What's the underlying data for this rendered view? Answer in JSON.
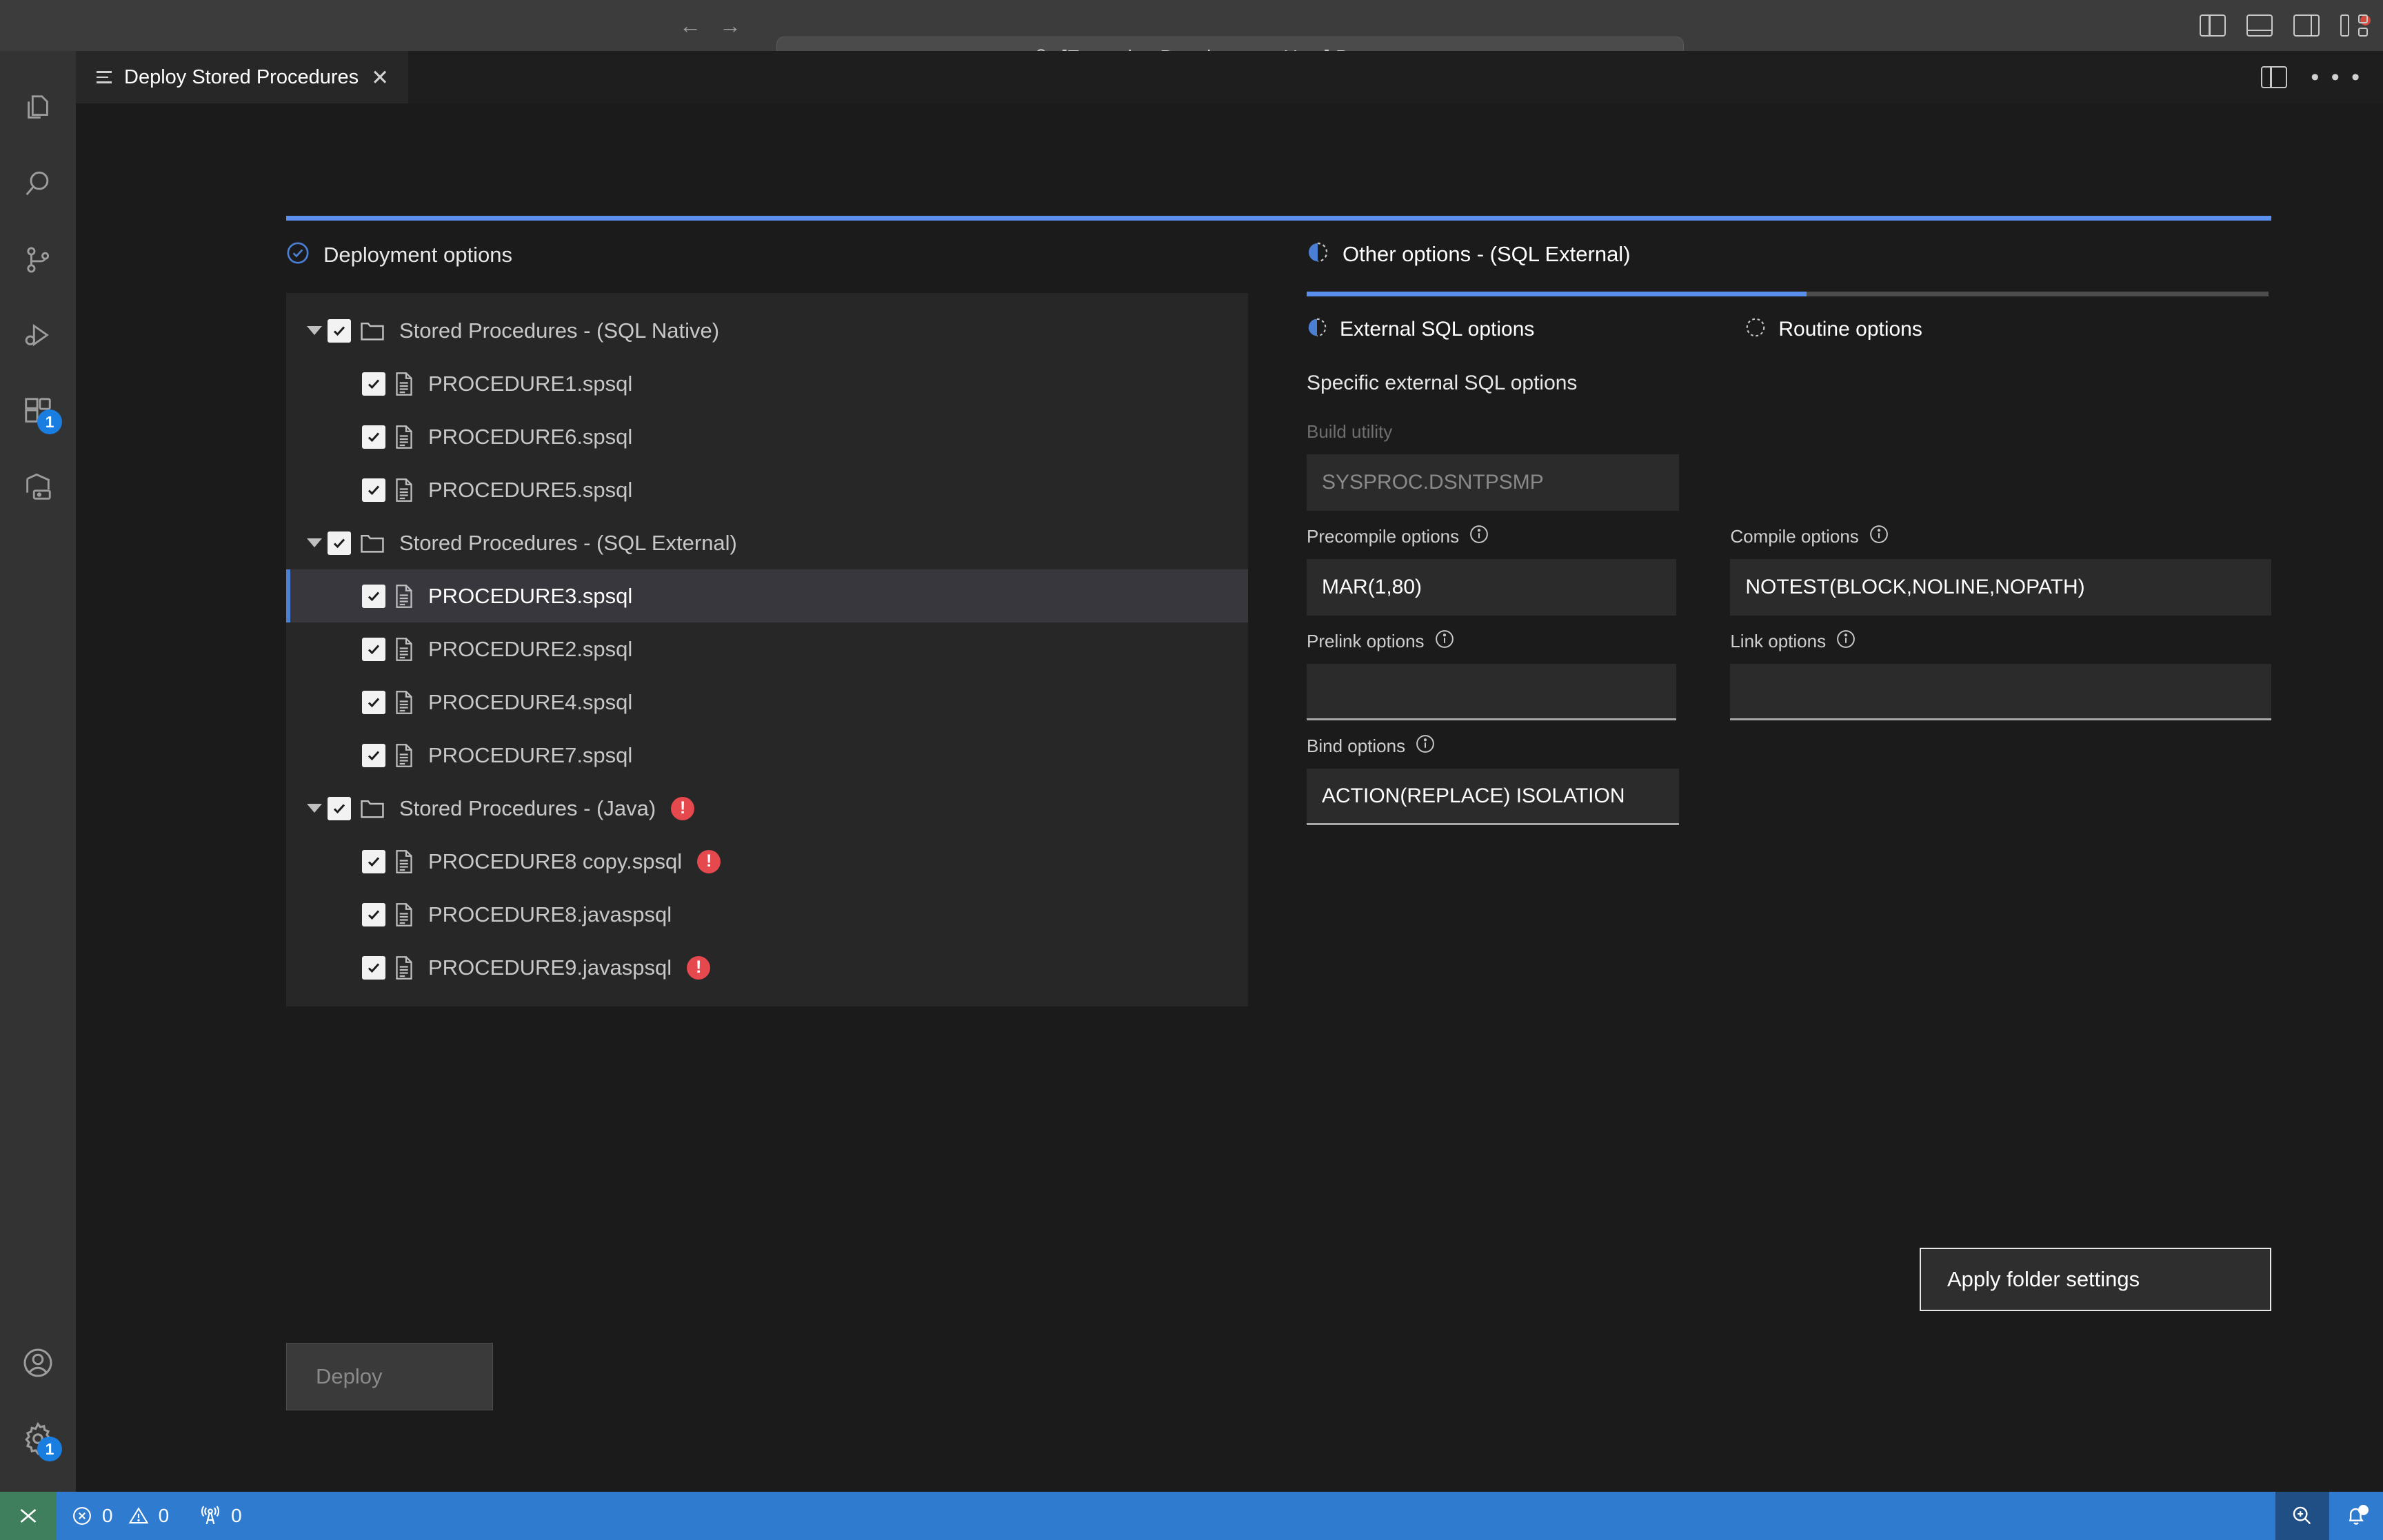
{
  "titlebar": {
    "back_icon": "arrow-left-icon",
    "forward_icon": "arrow-right-icon",
    "search_text": "[Extension Development Host] Document",
    "search_icon": "search-icon",
    "layout_buttons": [
      {
        "name": "toggle-primary-sidebar",
        "icon": "layout-sidebar-left-icon"
      },
      {
        "name": "toggle-panel",
        "icon": "layout-panel-icon"
      },
      {
        "name": "toggle-secondary-sidebar",
        "icon": "layout-sidebar-right-icon"
      },
      {
        "name": "customize-layout",
        "icon": "layout-customize-icon"
      }
    ]
  },
  "activitybar": {
    "top_items": [
      {
        "name": "explorer",
        "icon": "files-icon",
        "badge": ""
      },
      {
        "name": "search",
        "icon": "search-icon",
        "badge": ""
      },
      {
        "name": "source-control",
        "icon": "source-control-icon",
        "badge": ""
      },
      {
        "name": "run-and-debug",
        "icon": "run-debug-icon",
        "badge": ""
      },
      {
        "name": "extensions",
        "icon": "extensions-icon",
        "badge": "1"
      },
      {
        "name": "db-connections",
        "icon": "database-icon",
        "badge": ""
      }
    ],
    "bottom_items": [
      {
        "name": "accounts",
        "icon": "account-icon",
        "badge": ""
      },
      {
        "name": "manage-settings",
        "icon": "gear-icon",
        "badge": "1"
      }
    ]
  },
  "tabbar": {
    "tab_icon": "list-icon",
    "tab_title": "Deploy Stored Procedures",
    "close_icon": "close-icon",
    "split_editor_icon": "split-editor-icon",
    "more_actions_icon": "more-actions-icon",
    "more_actions_glyph": "• • •"
  },
  "left_pane": {
    "title": "Deployment options",
    "title_icon": "check-circle-icon",
    "tree": [
      {
        "type": "folder",
        "label": "Stored Procedures - (SQL Native)",
        "checked": true,
        "expanded": true,
        "error": false,
        "selected": false
      },
      {
        "type": "file",
        "label": "PROCEDURE1.spsql",
        "checked": true,
        "error": false,
        "selected": false
      },
      {
        "type": "file",
        "label": "PROCEDURE6.spsql",
        "checked": true,
        "error": false,
        "selected": false
      },
      {
        "type": "file",
        "label": "PROCEDURE5.spsql",
        "checked": true,
        "error": false,
        "selected": false
      },
      {
        "type": "folder",
        "label": "Stored Procedures - (SQL External)",
        "checked": true,
        "expanded": true,
        "error": false,
        "selected": false
      },
      {
        "type": "file",
        "label": "PROCEDURE3.spsql",
        "checked": true,
        "error": false,
        "selected": true
      },
      {
        "type": "file",
        "label": "PROCEDURE2.spsql",
        "checked": true,
        "error": false,
        "selected": false
      },
      {
        "type": "file",
        "label": "PROCEDURE4.spsql",
        "checked": true,
        "error": false,
        "selected": false
      },
      {
        "type": "file",
        "label": "PROCEDURE7.spsql",
        "checked": true,
        "error": false,
        "selected": false
      },
      {
        "type": "folder",
        "label": "Stored Procedures - (Java)",
        "checked": true,
        "expanded": true,
        "error": true,
        "selected": false
      },
      {
        "type": "file",
        "label": "PROCEDURE8 copy.spsql",
        "checked": true,
        "error": true,
        "selected": false
      },
      {
        "type": "file",
        "label": "PROCEDURE8.javaspsql",
        "checked": true,
        "error": false,
        "selected": false
      },
      {
        "type": "file",
        "label": "PROCEDURE9.javaspsql",
        "checked": true,
        "error": true,
        "selected": false
      }
    ],
    "deploy_button": "Deploy"
  },
  "right_pane": {
    "title": "Other options - (SQL External)",
    "title_icon": "half-circle-icon",
    "progress_percent": 52,
    "tabs": [
      {
        "name": "external-sql-options",
        "label": "External SQL options",
        "icon": "half-circle-icon",
        "active": true
      },
      {
        "name": "routine-options",
        "label": "Routine options",
        "icon": "dotted-circle-icon",
        "active": false
      }
    ],
    "subtitle": "Specific external SQL options",
    "fields": [
      {
        "name": "build-utility",
        "label": "Build utility",
        "value": "SYSPROC.DSNTPSMP",
        "disabled": true,
        "info": false,
        "underline": false
      },
      {
        "name": "precompile-options",
        "label": "Precompile options",
        "value": "MAR(1,80)",
        "disabled": false,
        "info": true,
        "underline": false
      },
      {
        "name": "compile-options",
        "label": "Compile options",
        "value": "NOTEST(BLOCK,NOLINE,NOPATH)",
        "disabled": false,
        "info": true,
        "underline": false
      },
      {
        "name": "prelink-options",
        "label": "Prelink options",
        "value": "",
        "disabled": false,
        "info": true,
        "underline": true
      },
      {
        "name": "link-options",
        "label": "Link options",
        "value": "",
        "disabled": false,
        "info": true,
        "underline": true
      },
      {
        "name": "bind-options",
        "label": "Bind options",
        "value": "ACTION(REPLACE) ISOLATION",
        "disabled": false,
        "info": true,
        "underline": true
      }
    ],
    "info_icon": "info-icon",
    "apply_button": "Apply folder settings"
  },
  "statusbar": {
    "remote_icon": "remote-window-icon",
    "errors_icon": "error-circle-icon",
    "errors_count": "0",
    "warnings_icon": "warning-triangle-icon",
    "warnings_count": "0",
    "ports_icon": "radio-tower-icon",
    "ports_count": "0",
    "zoom_icon": "zoom-in-icon",
    "bell_icon": "bell-dot-icon"
  },
  "colors": {
    "accent_blue": "#5b8fee",
    "status_blue": "#2f7bd0",
    "error_red": "#e5484d",
    "remote_green": "#3f7f5d",
    "badge_blue": "#1a7ee0"
  }
}
